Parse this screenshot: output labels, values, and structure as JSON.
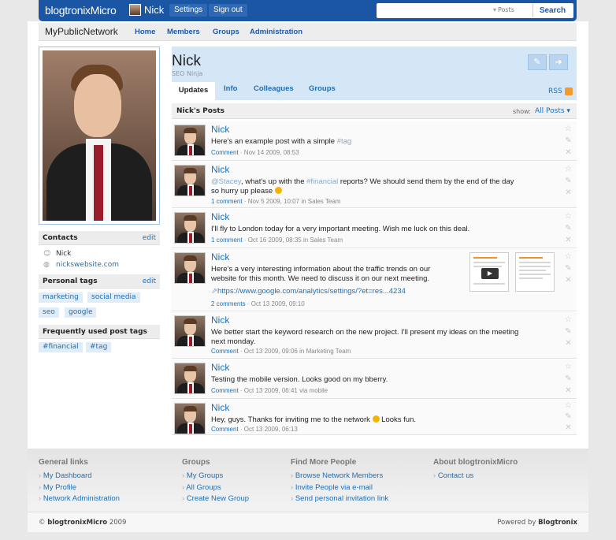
{
  "topbar": {
    "logo": "blogtronixMicro",
    "user_name": "Nick",
    "settings_label": "Settings",
    "signout_label": "Sign out",
    "search_placeholder": "",
    "search_scope": "Posts",
    "search_button": "Search"
  },
  "nav": {
    "network_name": "MyPublicNetwork",
    "links": [
      "Home",
      "Members",
      "Groups",
      "Administration"
    ]
  },
  "profile": {
    "name": "Nick",
    "title": "SEO Ninja",
    "tabs": [
      "Updates",
      "Info",
      "Colleagues",
      "Groups"
    ],
    "rss_label": "RSS"
  },
  "sidebar": {
    "contacts_title": "Contacts",
    "edit_label": "edit",
    "contact_name": "Nick",
    "contact_website": "nickswebsite.com",
    "personal_tags_title": "Personal tags",
    "personal_tags": [
      "marketing",
      "social media",
      "seo",
      "google"
    ],
    "post_tags_title": "Frequently used post tags",
    "post_tags": [
      "#financial",
      "#tag"
    ]
  },
  "posts_header": {
    "title": "Nick's Posts",
    "show_label": "show:",
    "show_value": "All Posts"
  },
  "posts": [
    {
      "author": "Nick",
      "text_before": "Here's an example post with a simple ",
      "hashtag": "#tag",
      "comments": "Comment",
      "date": "Nov 14 2009, 08:53",
      "context_prefix": "",
      "context": ""
    },
    {
      "author": "Nick",
      "mention": "@Stacey",
      "text_mid": ", what's up with the ",
      "hashtag": "#financial",
      "text_after_line1": " reports? We should send them by the end of the day",
      "text_line2": "so hurry up please",
      "comments": "1 comment",
      "date": "Nov 5 2009, 10:07",
      "context_prefix": "in",
      "context": "Sales Team"
    },
    {
      "author": "Nick",
      "text": "I'll fly to London today for a very important meeting. Wish me luck on this deal.",
      "comments": "1 comment",
      "date": "Oct 16 2009, 08:35",
      "context_prefix": "in",
      "context": "Sales Team"
    },
    {
      "author": "Nick",
      "text_line1": "Here's a very interesting information about the traffic trends on our",
      "text_line2": "website for this month. We need to discuss it on our next meeting.",
      "link": "https://www.google.com/analytics/settings/?et=res...4234",
      "comments": "2 comments",
      "date": "Oct 13 2009, 09:10",
      "context_prefix": "",
      "context": ""
    },
    {
      "author": "Nick",
      "text_line1": "We better start the keyword research on the new project. I'll present my ideas on the meeting",
      "text_line2": "next monday.",
      "comments": "Comment",
      "date": "Oct 13 2009, 09:06",
      "context_prefix": "in",
      "context": "Marketing Team"
    },
    {
      "author": "Nick",
      "text": "Testing the mobile version. Looks good on my bberry.",
      "comments": "Comment",
      "date": "Oct 13 2009, 06:41",
      "context_prefix": "via",
      "context": "mobile"
    },
    {
      "author": "Nick",
      "text_before": "Hey, guys. Thanks for inviting me to the network ",
      "text_after": " Looks fun.",
      "comments": "Comment",
      "date": "Oct 13 2009, 06:13",
      "context_prefix": "",
      "context": ""
    }
  ],
  "footer": {
    "general_title": "General links",
    "general_links": [
      "My Dashboard",
      "My Profile",
      "Network Administration"
    ],
    "groups_title": "Groups",
    "groups_links": [
      "My Groups",
      "All Groups",
      "Create New Group"
    ],
    "people_title": "Find More People",
    "people_links": [
      "Browse Network Members",
      "Invite People via e-mail",
      "Send personal invitation link"
    ],
    "about_title": "About blogtronixMicro",
    "about_links": [
      "Contact us"
    ],
    "copyright_symbol": "©",
    "copyright_brand": "blogtronixMicro",
    "copyright_year": "2009",
    "powered_prefix": "Powered by",
    "powered_brand": "Blogtronix"
  },
  "colors": {
    "brand_blue": "#1a56a3",
    "link_blue": "#1f6fb5",
    "profile_header_bg": "#d5e6f6"
  }
}
